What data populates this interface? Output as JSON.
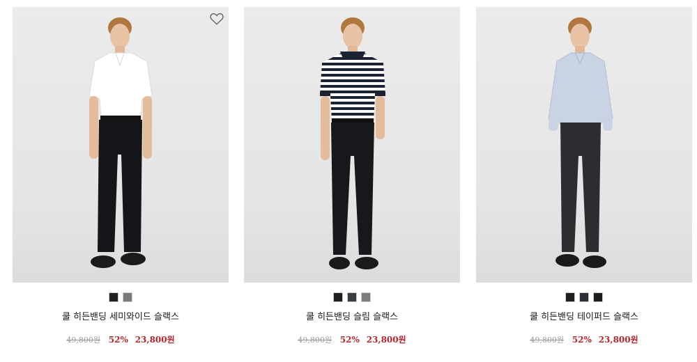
{
  "products": [
    {
      "name": "쿨 히든밴딩 세미와이드 슬랙스",
      "original_price": "49,800원",
      "discount_rate": "52%",
      "sale_price": "23,800원",
      "colors": [
        "#202020",
        "#7a7a7a"
      ],
      "model": {
        "shirt": "white",
        "pants": "#15161a",
        "shoes": "#1a1a1a"
      },
      "wishlist_icon": "heart-outline-icon"
    },
    {
      "name": "쿨 히든밴딩 슬림 슬랙스",
      "original_price": "49,800원",
      "discount_rate": "52%",
      "sale_price": "23,800원",
      "colors": [
        "#1f1f1f",
        "#3a3d40",
        "#7d7d7d"
      ],
      "model": {
        "shirt": "navy-stripe-polo",
        "pants": "#17181b",
        "shoes": "#1a1a1a"
      }
    },
    {
      "name": "쿨 히든밴딩 테이퍼드 슬랙스",
      "original_price": "49,800원",
      "discount_rate": "52%",
      "sale_price": "23,800원",
      "colors": [
        "#1f1f1f",
        "#2d2f36",
        "#1c1c1c"
      ],
      "model": {
        "shirt": "light-blue",
        "pants": "#2c2d30",
        "shoes": "#1a1a1a"
      }
    }
  ]
}
